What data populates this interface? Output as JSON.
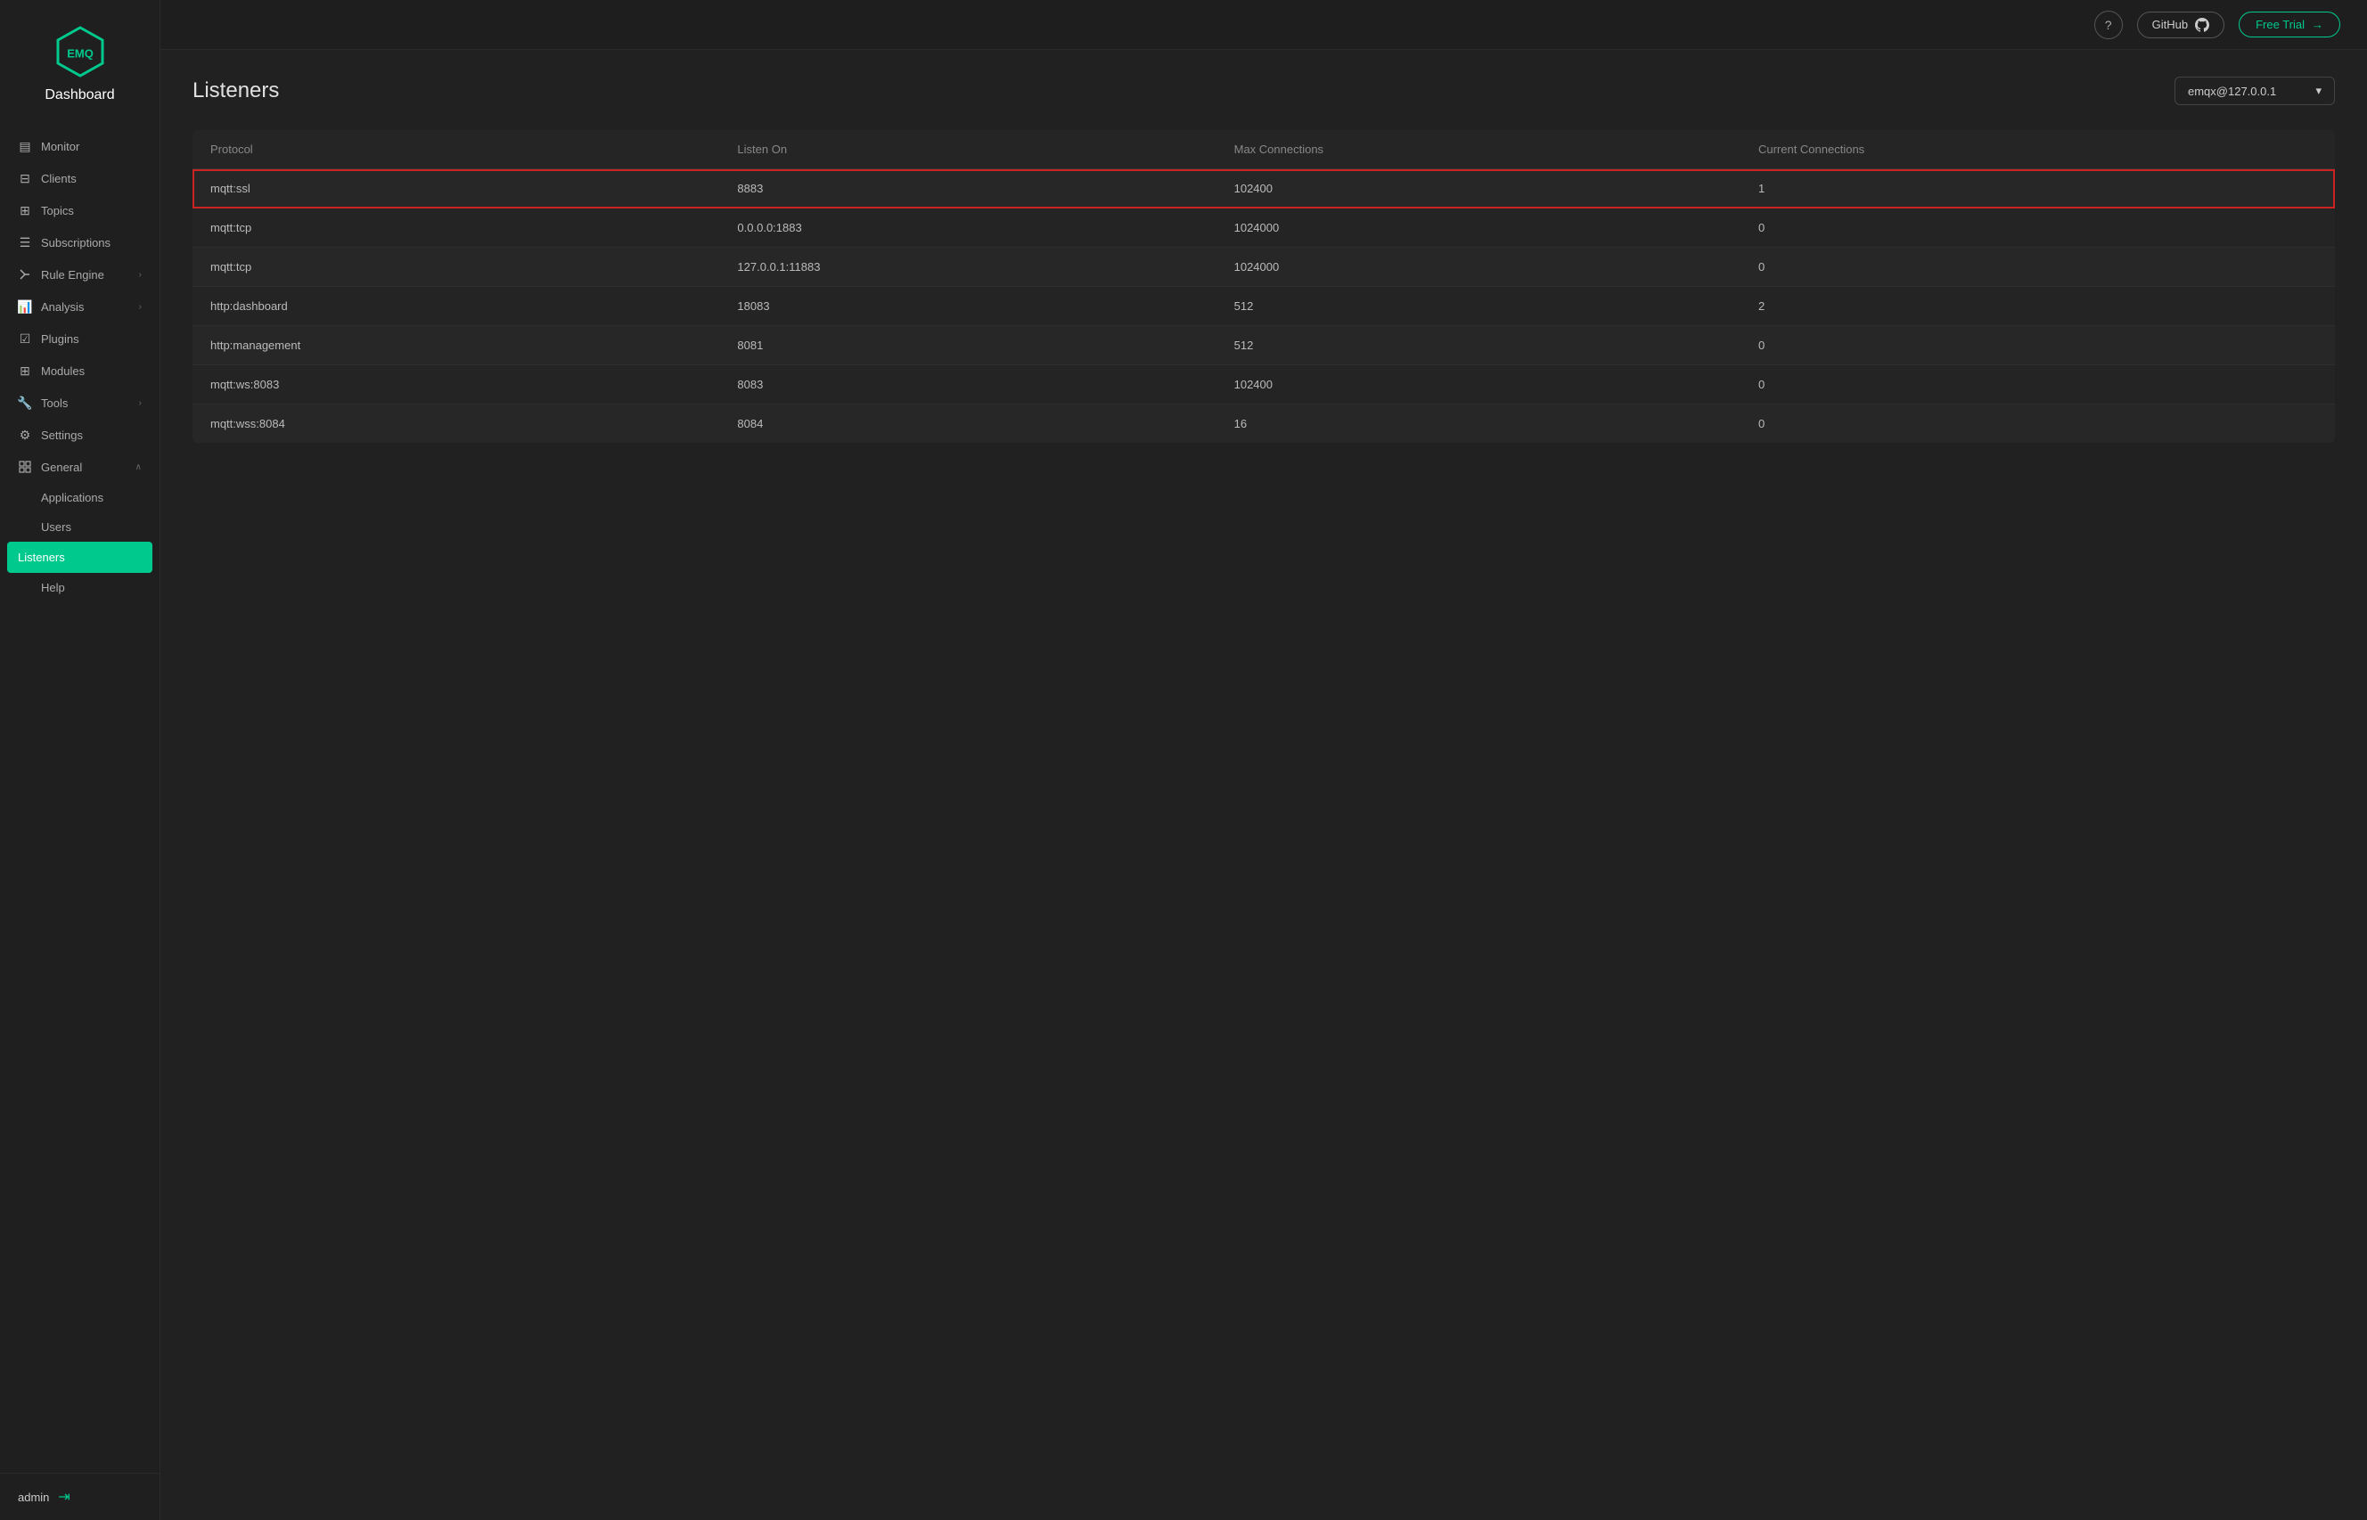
{
  "brand": {
    "logo_text": "EMQ",
    "dashboard_label": "Dashboard"
  },
  "topbar": {
    "help_icon": "?",
    "github_label": "GitHub",
    "github_icon": "⬡",
    "free_trial_label": "Free Trial",
    "free_trial_icon": "→"
  },
  "sidebar": {
    "items": [
      {
        "id": "monitor",
        "label": "Monitor",
        "icon": "▤",
        "expandable": false
      },
      {
        "id": "clients",
        "label": "Clients",
        "icon": "⊟",
        "expandable": false
      },
      {
        "id": "topics",
        "label": "Topics",
        "icon": "⊞",
        "expandable": false
      },
      {
        "id": "subscriptions",
        "label": "Subscriptions",
        "icon": "☰",
        "expandable": false
      },
      {
        "id": "rule-engine",
        "label": "Rule Engine",
        "icon": "⚡",
        "expandable": true
      },
      {
        "id": "analysis",
        "label": "Analysis",
        "icon": "⬡",
        "expandable": true
      },
      {
        "id": "plugins",
        "label": "Plugins",
        "icon": "✓",
        "expandable": false
      },
      {
        "id": "modules",
        "label": "Modules",
        "icon": "⊞",
        "expandable": false
      },
      {
        "id": "tools",
        "label": "Tools",
        "icon": "⚙",
        "expandable": true
      },
      {
        "id": "settings",
        "label": "Settings",
        "icon": "⚙",
        "expandable": false
      },
      {
        "id": "general",
        "label": "General",
        "icon": "⊟",
        "expandable": true
      }
    ],
    "subitems": [
      {
        "id": "applications",
        "label": "Applications"
      },
      {
        "id": "users",
        "label": "Users"
      },
      {
        "id": "listeners",
        "label": "Listeners",
        "active": true
      },
      {
        "id": "help",
        "label": "Help"
      }
    ],
    "footer": {
      "username": "admin",
      "logout_icon": "⇥"
    }
  },
  "page": {
    "title": "Listeners",
    "node_selector": "emqx@127.0.0.1",
    "chevron": "▾"
  },
  "table": {
    "columns": [
      "Protocol",
      "Listen On",
      "Max Connections",
      "Current Connections"
    ],
    "rows": [
      {
        "protocol": "mqtt:ssl",
        "listen_on": "8883",
        "max_connections": "102400",
        "current_connections": "1",
        "highlighted": true
      },
      {
        "protocol": "mqtt:tcp",
        "listen_on": "0.0.0.0:1883",
        "max_connections": "1024000",
        "current_connections": "0",
        "highlighted": false
      },
      {
        "protocol": "mqtt:tcp",
        "listen_on": "127.0.0.1:11883",
        "max_connections": "1024000",
        "current_connections": "0",
        "highlighted": false
      },
      {
        "protocol": "http:dashboard",
        "listen_on": "18083",
        "max_connections": "512",
        "current_connections": "2",
        "highlighted": false
      },
      {
        "protocol": "http:management",
        "listen_on": "8081",
        "max_connections": "512",
        "current_connections": "0",
        "highlighted": false
      },
      {
        "protocol": "mqtt:ws:8083",
        "listen_on": "8083",
        "max_connections": "102400",
        "current_connections": "0",
        "highlighted": false
      },
      {
        "protocol": "mqtt:wss:8084",
        "listen_on": "8084",
        "max_connections": "16",
        "current_connections": "0",
        "highlighted": false
      }
    ]
  }
}
